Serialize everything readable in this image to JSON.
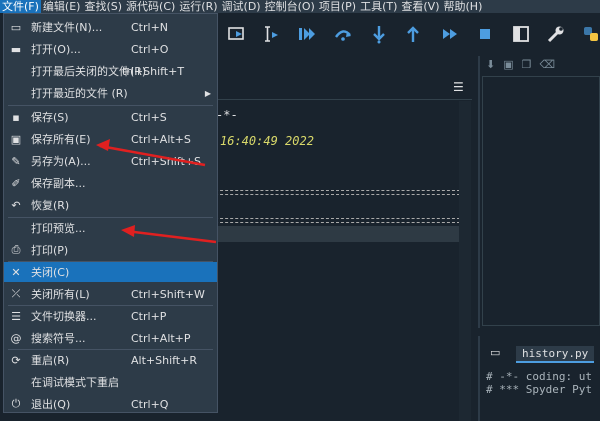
{
  "menubar": {
    "items": [
      {
        "label": "文件(F)",
        "active": true
      },
      {
        "label": "编辑(E)"
      },
      {
        "label": "查找(S)"
      },
      {
        "label": "源代码(C)"
      },
      {
        "label": "运行(R)"
      },
      {
        "label": "调试(D)"
      },
      {
        "label": "控制台(O)"
      },
      {
        "label": "项目(P)"
      },
      {
        "label": "工具(T)"
      },
      {
        "label": "查看(V)"
      },
      {
        "label": "帮助(H)"
      }
    ]
  },
  "file_menu": {
    "items": [
      {
        "icon": "new-file-icon",
        "label": "新建文件(N)...",
        "shortcut": "Ctrl+N"
      },
      {
        "icon": "open-folder-icon",
        "label": "打开(O)...",
        "shortcut": "Ctrl+O"
      },
      {
        "icon": "",
        "label": "打开最后关闭的文件(R)",
        "shortcut": "trl+Shift+T"
      },
      {
        "icon": "",
        "label": "打开最近的文件 (R)",
        "shortcut": "",
        "submenu": true
      },
      {
        "icon": "save-icon",
        "label": "保存(S)",
        "shortcut": "Ctrl+S"
      },
      {
        "icon": "save-all-icon",
        "label": "保存所有(E)",
        "shortcut": "Ctrl+Alt+S"
      },
      {
        "icon": "save-as-icon",
        "label": "另存为(A)...",
        "shortcut": "Ctrl+Shift+S"
      },
      {
        "icon": "save-copy-icon",
        "label": "保存副本...",
        "shortcut": ""
      },
      {
        "icon": "revert-icon",
        "label": "恢复(R)",
        "shortcut": ""
      },
      {
        "icon": "",
        "label": "打印预览...",
        "shortcut": ""
      },
      {
        "icon": "print-icon",
        "label": "打印(P)",
        "shortcut": ""
      },
      {
        "icon": "close-icon",
        "label": "关闭(C)",
        "shortcut": "",
        "highlighted": true
      },
      {
        "icon": "close-all-icon",
        "label": "关闭所有(L)",
        "shortcut": "Ctrl+Shift+W"
      },
      {
        "icon": "file-switcher-icon",
        "label": "文件切换器...",
        "shortcut": "Ctrl+P"
      },
      {
        "icon": "symbol-search-icon",
        "label": "搜索符号...",
        "shortcut": "Ctrl+Alt+P"
      },
      {
        "icon": "restart-icon",
        "label": "重启(R)",
        "shortcut": "Alt+Shift+R"
      },
      {
        "icon": "",
        "label": "在调试模式下重启",
        "shortcut": ""
      },
      {
        "icon": "power-icon",
        "label": "退出(Q)",
        "shortcut": "Ctrl+Q"
      }
    ]
  },
  "editor": {
    "line1": "-*-",
    "line2": "16:40:49 2022"
  },
  "history": {
    "tab": "history.py",
    "line1": "# -*- coding: ut",
    "line2": "# *** Spyder Pyt"
  },
  "colors": {
    "accent": "#1a72bb",
    "menu_bg": "#2d3b48",
    "bg": "#19232d",
    "arrow": "#e02020"
  }
}
